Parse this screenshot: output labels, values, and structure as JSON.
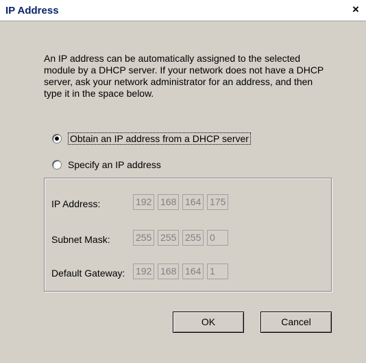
{
  "window": {
    "title": "IP Address",
    "close_glyph": "×"
  },
  "description": "An IP address can be automatically assigned to the selected module by a DHCP server. If your network does not have a DHCP server, ask your network administrator for an address, and then type it in the space below.",
  "options": {
    "dhcp": {
      "label": "Obtain an IP address from a DHCP server",
      "checked": true
    },
    "static": {
      "label": "Specify an IP address",
      "checked": false
    }
  },
  "fields": {
    "ip_address": {
      "label": "IP Address:",
      "octets": [
        "192",
        "168",
        "164",
        "175"
      ]
    },
    "subnet_mask": {
      "label": "Subnet Mask:",
      "octets": [
        "255",
        "255",
        "255",
        "0"
      ]
    },
    "default_gateway": {
      "label": "Default Gateway:",
      "octets": [
        "192",
        "168",
        "164",
        "1"
      ]
    }
  },
  "buttons": {
    "ok": "OK",
    "cancel": "Cancel"
  },
  "colors": {
    "dialog_bg": "#d4d0c8",
    "title_text": "#0a246a",
    "disabled_text": "#808080"
  }
}
